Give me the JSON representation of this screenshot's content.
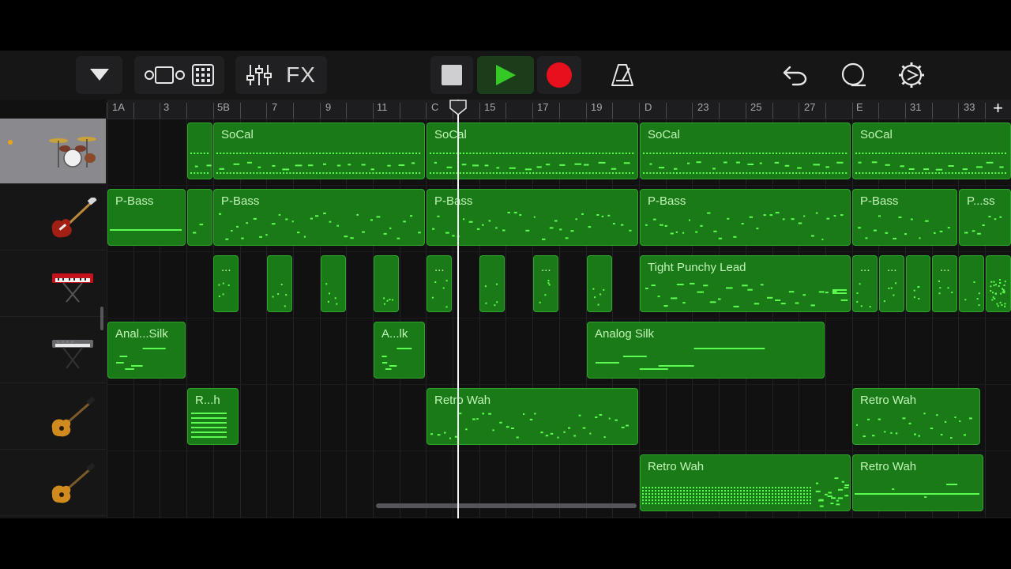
{
  "toolbar": {
    "fx_label": "FX",
    "icons": [
      "tracks-dropdown-icon",
      "view-toggle-icon",
      "grid-view-icon",
      "mixer-icon",
      "fx-button",
      "stop-icon",
      "play-icon",
      "record-icon",
      "metronome-icon",
      "undo-icon",
      "loop-browser-icon",
      "settings-icon"
    ]
  },
  "ruler": {
    "marks": [
      "1A",
      "3",
      "5B",
      "7",
      "9",
      "11",
      "C",
      "15",
      "17",
      "19",
      "D",
      "23",
      "25",
      "27",
      "E",
      "31",
      "33"
    ],
    "add_label": "+"
  },
  "tracks": [
    {
      "name": "drums",
      "instrument": "drum-kit-icon",
      "selected": true
    },
    {
      "name": "bass",
      "instrument": "bass-guitar-icon",
      "selected": false
    },
    {
      "name": "keys",
      "instrument": "synth-keyboard-icon",
      "selected": false
    },
    {
      "name": "analog-synth",
      "instrument": "keyboard-stand-icon",
      "selected": false
    },
    {
      "name": "guitar-1",
      "instrument": "electric-guitar-icon",
      "selected": false
    },
    {
      "name": "guitar-2",
      "instrument": "electric-guitar-icon",
      "selected": false
    }
  ],
  "regions": {
    "drums": [
      "",
      "SoCal",
      "SoCal",
      "SoCal",
      "SoCal"
    ],
    "bass": [
      "P-Bass",
      "",
      "P-Bass",
      "P-Bass",
      "P-Bass",
      "P-Bass",
      "P...ss"
    ],
    "keys": [
      "...",
      "",
      "",
      "",
      "...",
      "",
      "...",
      "",
      "Tight Punchy Lead",
      "...",
      "...",
      "",
      "...",
      ""
    ],
    "synth": [
      "Anal...Silk",
      "A...lk",
      "Analog Silk"
    ],
    "guitar1": [
      "R...h",
      "Retro Wah",
      "Retro Wah"
    ],
    "guitar2": [
      "Retro Wah",
      "Retro Wah"
    ]
  },
  "colors": {
    "region_fill": "#1b7a18",
    "region_border": "#2ea42a",
    "note": "#5cff4f",
    "record": "#e8101c",
    "play": "#35c925"
  }
}
